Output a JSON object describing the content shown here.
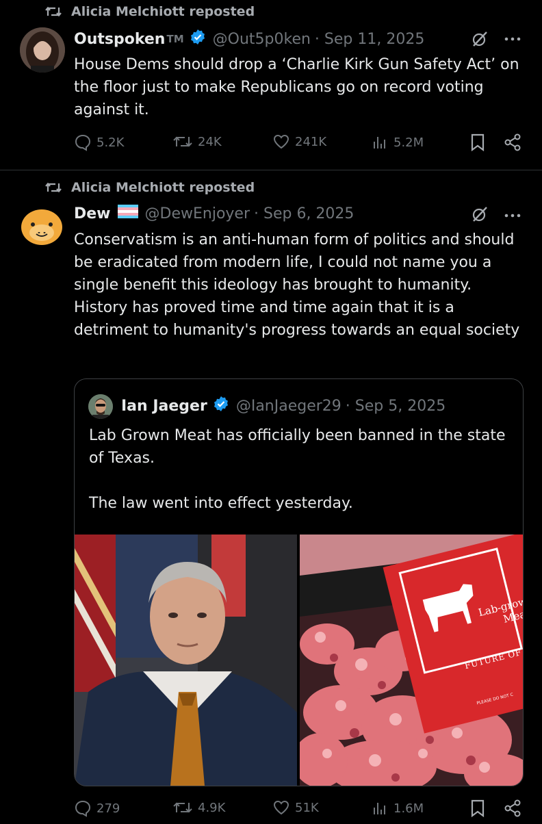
{
  "theme": {
    "background": "#000000",
    "text": "#e7e9ea",
    "muted": "#71767b",
    "verified": "#1d9bf0"
  },
  "posts": [
    {
      "reposted_by": "Alicia Melchiott reposted",
      "author": {
        "name": "Outspoken",
        "suffix": "TM",
        "handle": "@Out5p0ken",
        "date": "· Sep 11, 2025",
        "verified": true
      },
      "text": "House Dems should drop a ‘Charlie Kirk Gun Safety Act’ on the floor just to make Republicans go on record voting against it.",
      "stats": {
        "replies": "5.2K",
        "reposts": "24K",
        "likes": "241K",
        "views": "5.2M"
      }
    },
    {
      "reposted_by": "Alicia Melchiott reposted",
      "author": {
        "name": "Dew",
        "handle": "@DewEnjoyer",
        "date": "· Sep 6, 2025",
        "flag": "trans-flag"
      },
      "text": "Conservatism is an anti-human form of politics and should be eradicated from modern life, I could not name you a single benefit this ideology has brought to humanity. History has proved time and time again that it is a detriment to humanity's progress towards an equal society",
      "quote": {
        "author": {
          "name": "Ian Jaeger",
          "handle": "@IanJaeger29",
          "date": "· Sep 5, 2025",
          "verified": true
        },
        "text": "Lab Grown Meat has officially been banned in the state of Texas.\n\nThe law went into effect yesterday.",
        "images": [
          {
            "icon": "man-in-suit-photo"
          },
          {
            "icon": "lab-grown-meat-photo",
            "package_label_1": "Lab-grow",
            "package_label_2": "Meat",
            "package_label_3": "FUTURE OF",
            "package_fine_print": "PLEASE DO NOT C"
          }
        ]
      },
      "stats": {
        "replies": "279",
        "reposts": "4.9K",
        "likes": "51K",
        "views": "1.6M"
      }
    }
  ]
}
